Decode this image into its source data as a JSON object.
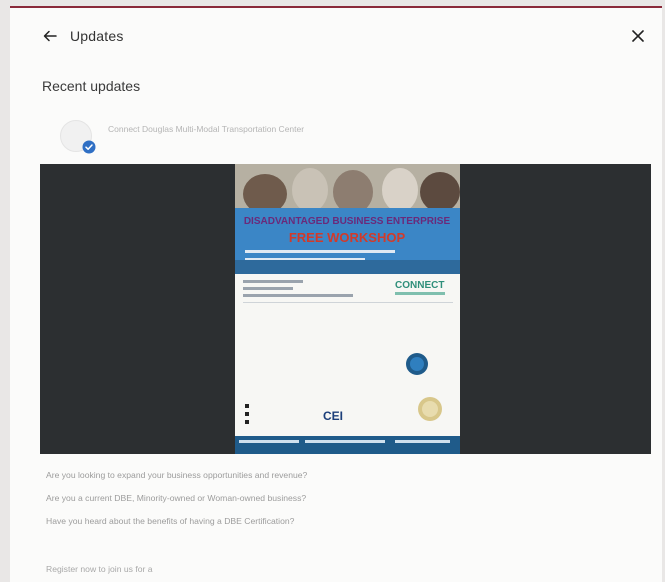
{
  "header": {
    "title": "Updates"
  },
  "section": {
    "title": "Recent updates"
  },
  "post": {
    "author": "Connect Douglas Multi-Modal Transportation Center",
    "body": [
      "Are you looking to expand your business opportunities and revenue?",
      "Are you a current DBE, Minority-owned or Woman-owned business?",
      "Have you heard about the benefits of having a DBE Certification?"
    ],
    "cta": "Register now to join us for a"
  },
  "flyer": {
    "headline": "DISADVANTAGED BUSINESS ENTERPRISE",
    "subhead": "FREE WORKSHOP",
    "brand": "CONNECT",
    "logo": "CEI"
  },
  "colors": {
    "accent_border": "#8a2a3a",
    "verified_badge": "#2f6fc4",
    "media_bg": "#2c2f31"
  }
}
